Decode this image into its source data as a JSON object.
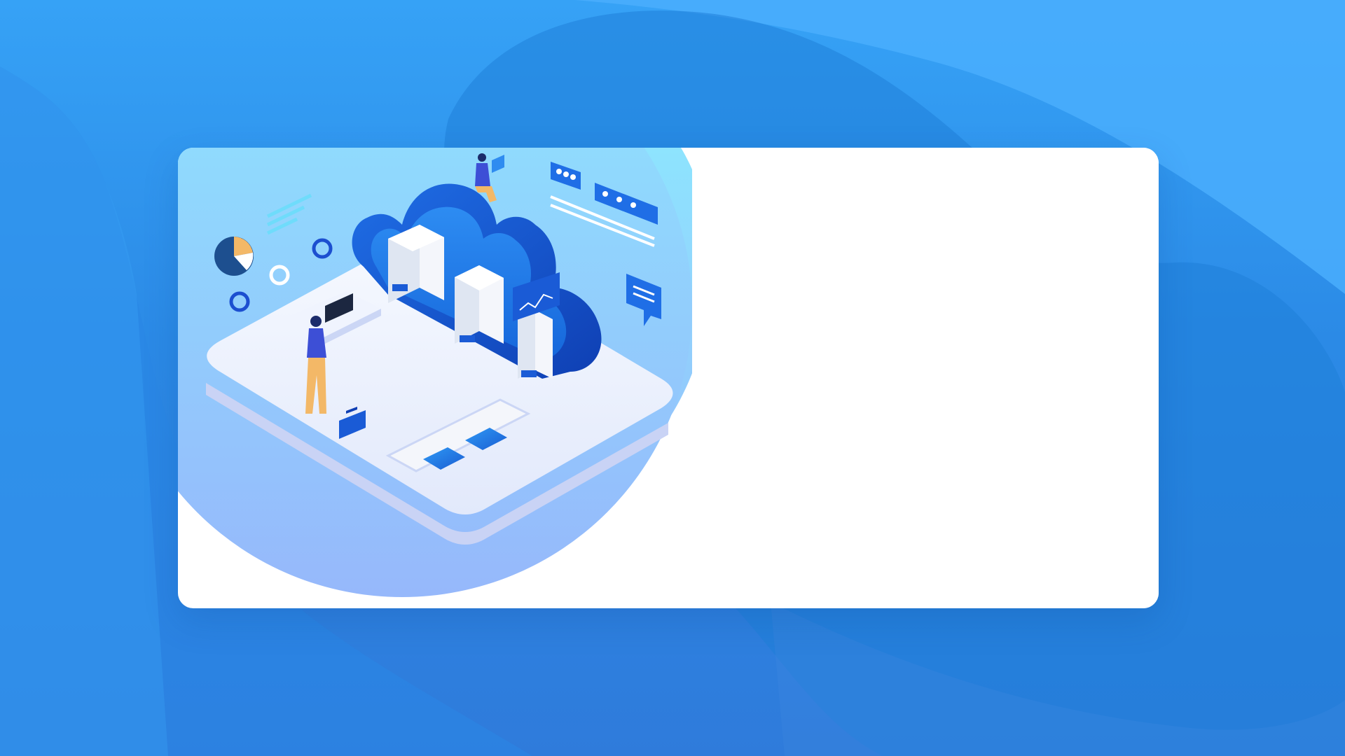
{
  "page": {
    "title": ""
  },
  "colors": {
    "background_top": "#36a2f6",
    "background_bottom": "#2f7bdb",
    "card_background": "#ffffff",
    "illustration_circle_top": "#8fe3fd",
    "illustration_circle_bottom": "#95b9fb",
    "cloud_blue": "#1a5bd6",
    "platform": "#eef3ff"
  },
  "login_card": {
    "form_panel": {
      "visible_text": ""
    }
  },
  "illustration": {
    "subject": "cloud-computing-office",
    "icons": [
      "pie-chart-icon",
      "chat-bubble-icon",
      "ellipsis-bubble-icon",
      "briefcase-icon",
      "monitor-icon",
      "line-chart-icon"
    ]
  }
}
